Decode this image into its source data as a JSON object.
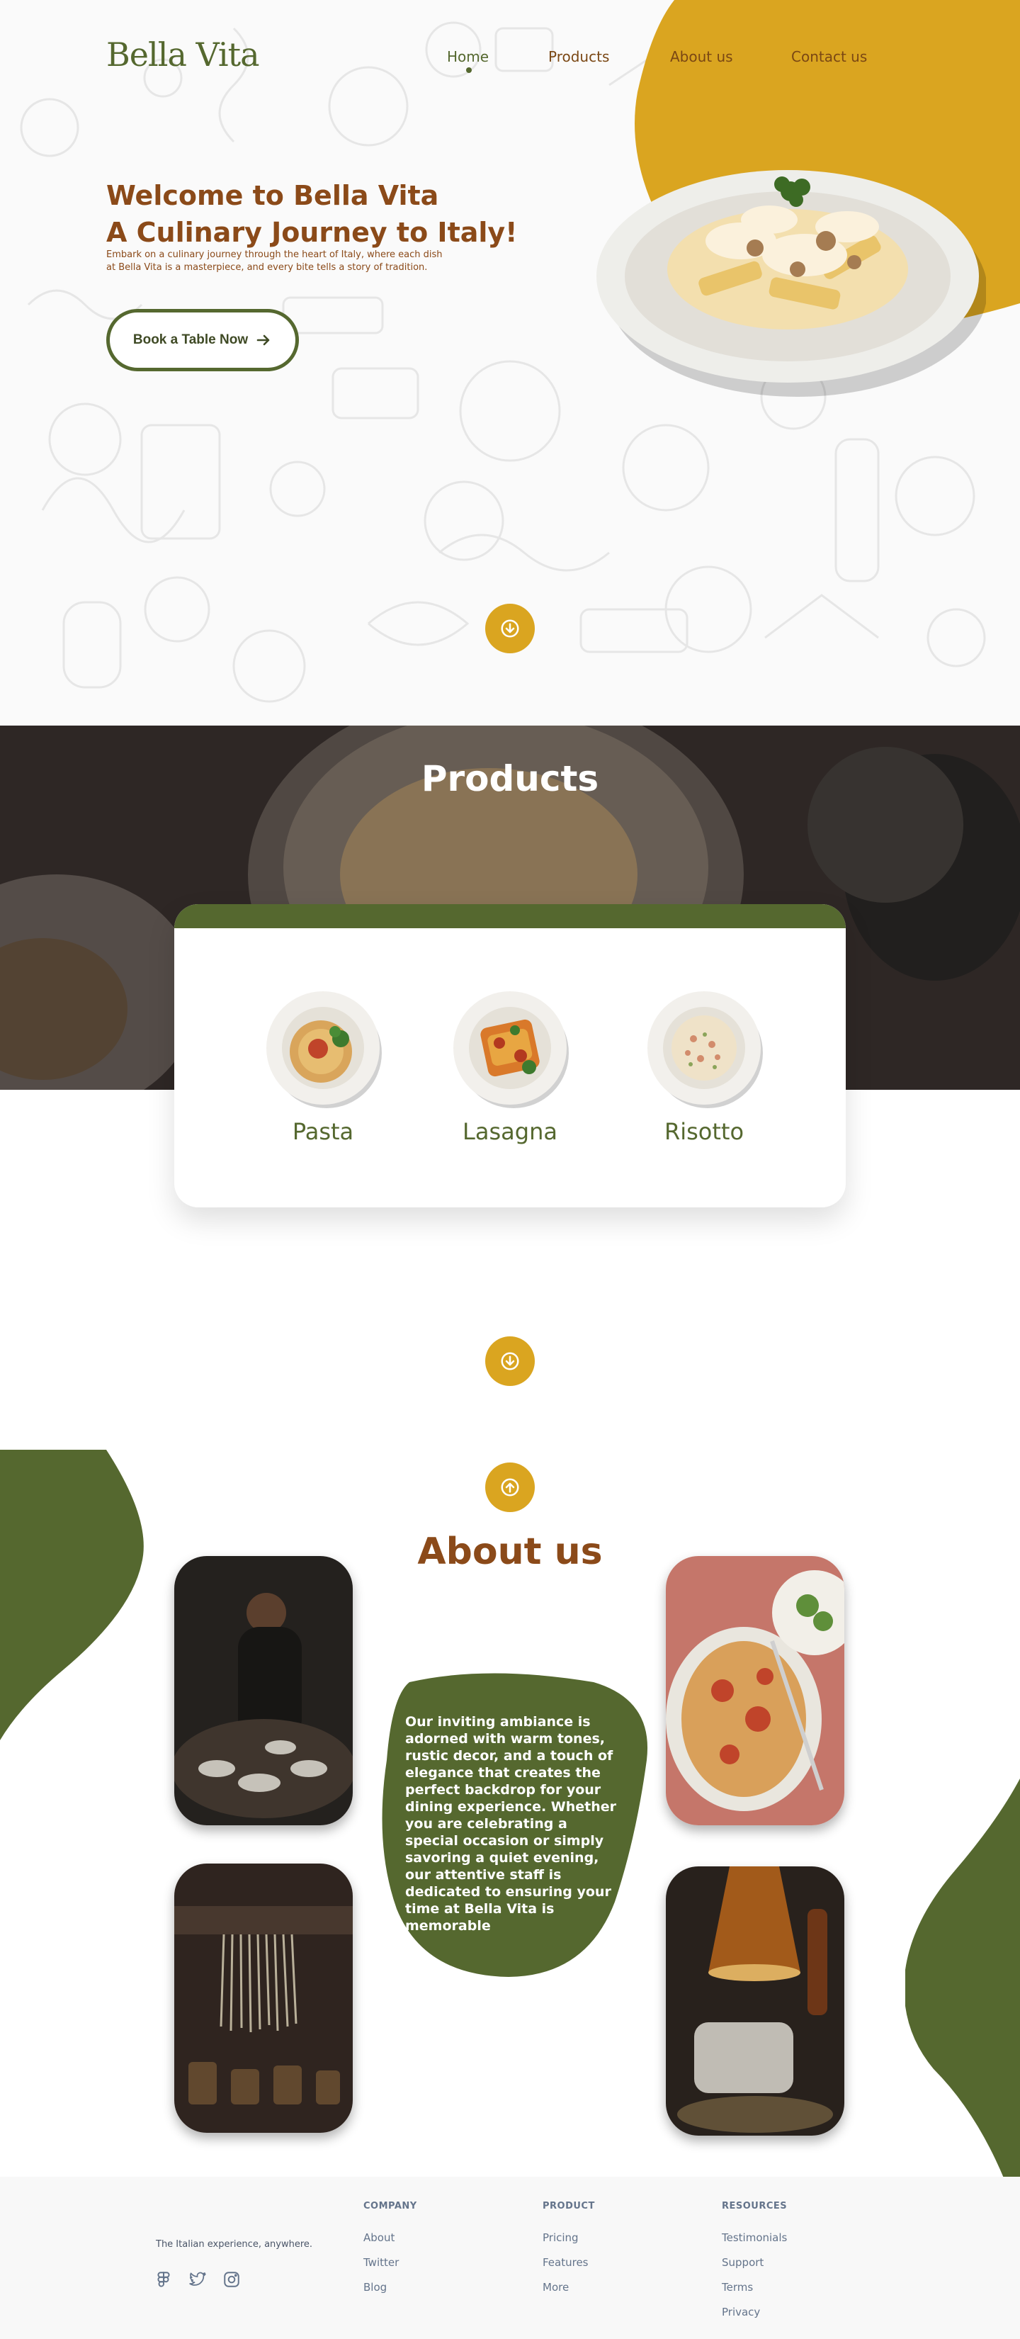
{
  "brand": {
    "name": "Bella Vita"
  },
  "nav": {
    "items": [
      {
        "label": "Home",
        "active": true
      },
      {
        "label": "Products",
        "active": false
      },
      {
        "label": "About us",
        "active": false
      },
      {
        "label": "Contact us",
        "active": false
      }
    ]
  },
  "hero": {
    "title_line1": "Welcome to Bella Vita",
    "title_line2": "A Culinary Journey to Italy!",
    "subtitle": "Embark on a culinary journey through the heart of Italy, where each dish at Bella Vita is a masterpiece, and every bite tells a story of tradition.",
    "cta_label": "Book a Table Now"
  },
  "products": {
    "title": "Products",
    "items": [
      {
        "name": "Pasta"
      },
      {
        "name": "Lasagna"
      },
      {
        "name": "Risotto"
      }
    ]
  },
  "about": {
    "title": "About us",
    "text": "Our inviting ambiance is adorned with warm tones, rustic decor, and a touch of elegance that creates the perfect backdrop for your dining experience. Whether you are celebrating a special occasion or simply savoring a quiet evening, our attentive staff is dedicated to ensuring your time at Bella Vita is memorable"
  },
  "footer": {
    "tagline": "The Italian experience, anywhere.",
    "columns": [
      {
        "title": "COMPANY",
        "links": [
          "About",
          "Twitter",
          "Blog"
        ]
      },
      {
        "title": "PRODUCT",
        "links": [
          "Pricing",
          "Features",
          "More"
        ]
      },
      {
        "title": "RESOURCES",
        "links": [
          "Testimonials",
          "Support",
          "Terms",
          "Privacy"
        ]
      }
    ]
  },
  "icons": {
    "scroll_down": "arrow-down-icon",
    "scroll_up": "arrow-up-icon",
    "cta_arrow": "arrow-right-icon",
    "socials": [
      "figma-icon",
      "twitter-icon",
      "instagram-icon"
    ]
  },
  "colors": {
    "brand_green": "#55682f",
    "brand_brown": "#8b4a19",
    "accent_gold": "#daa520",
    "footer_bg": "#f8f8f8"
  }
}
